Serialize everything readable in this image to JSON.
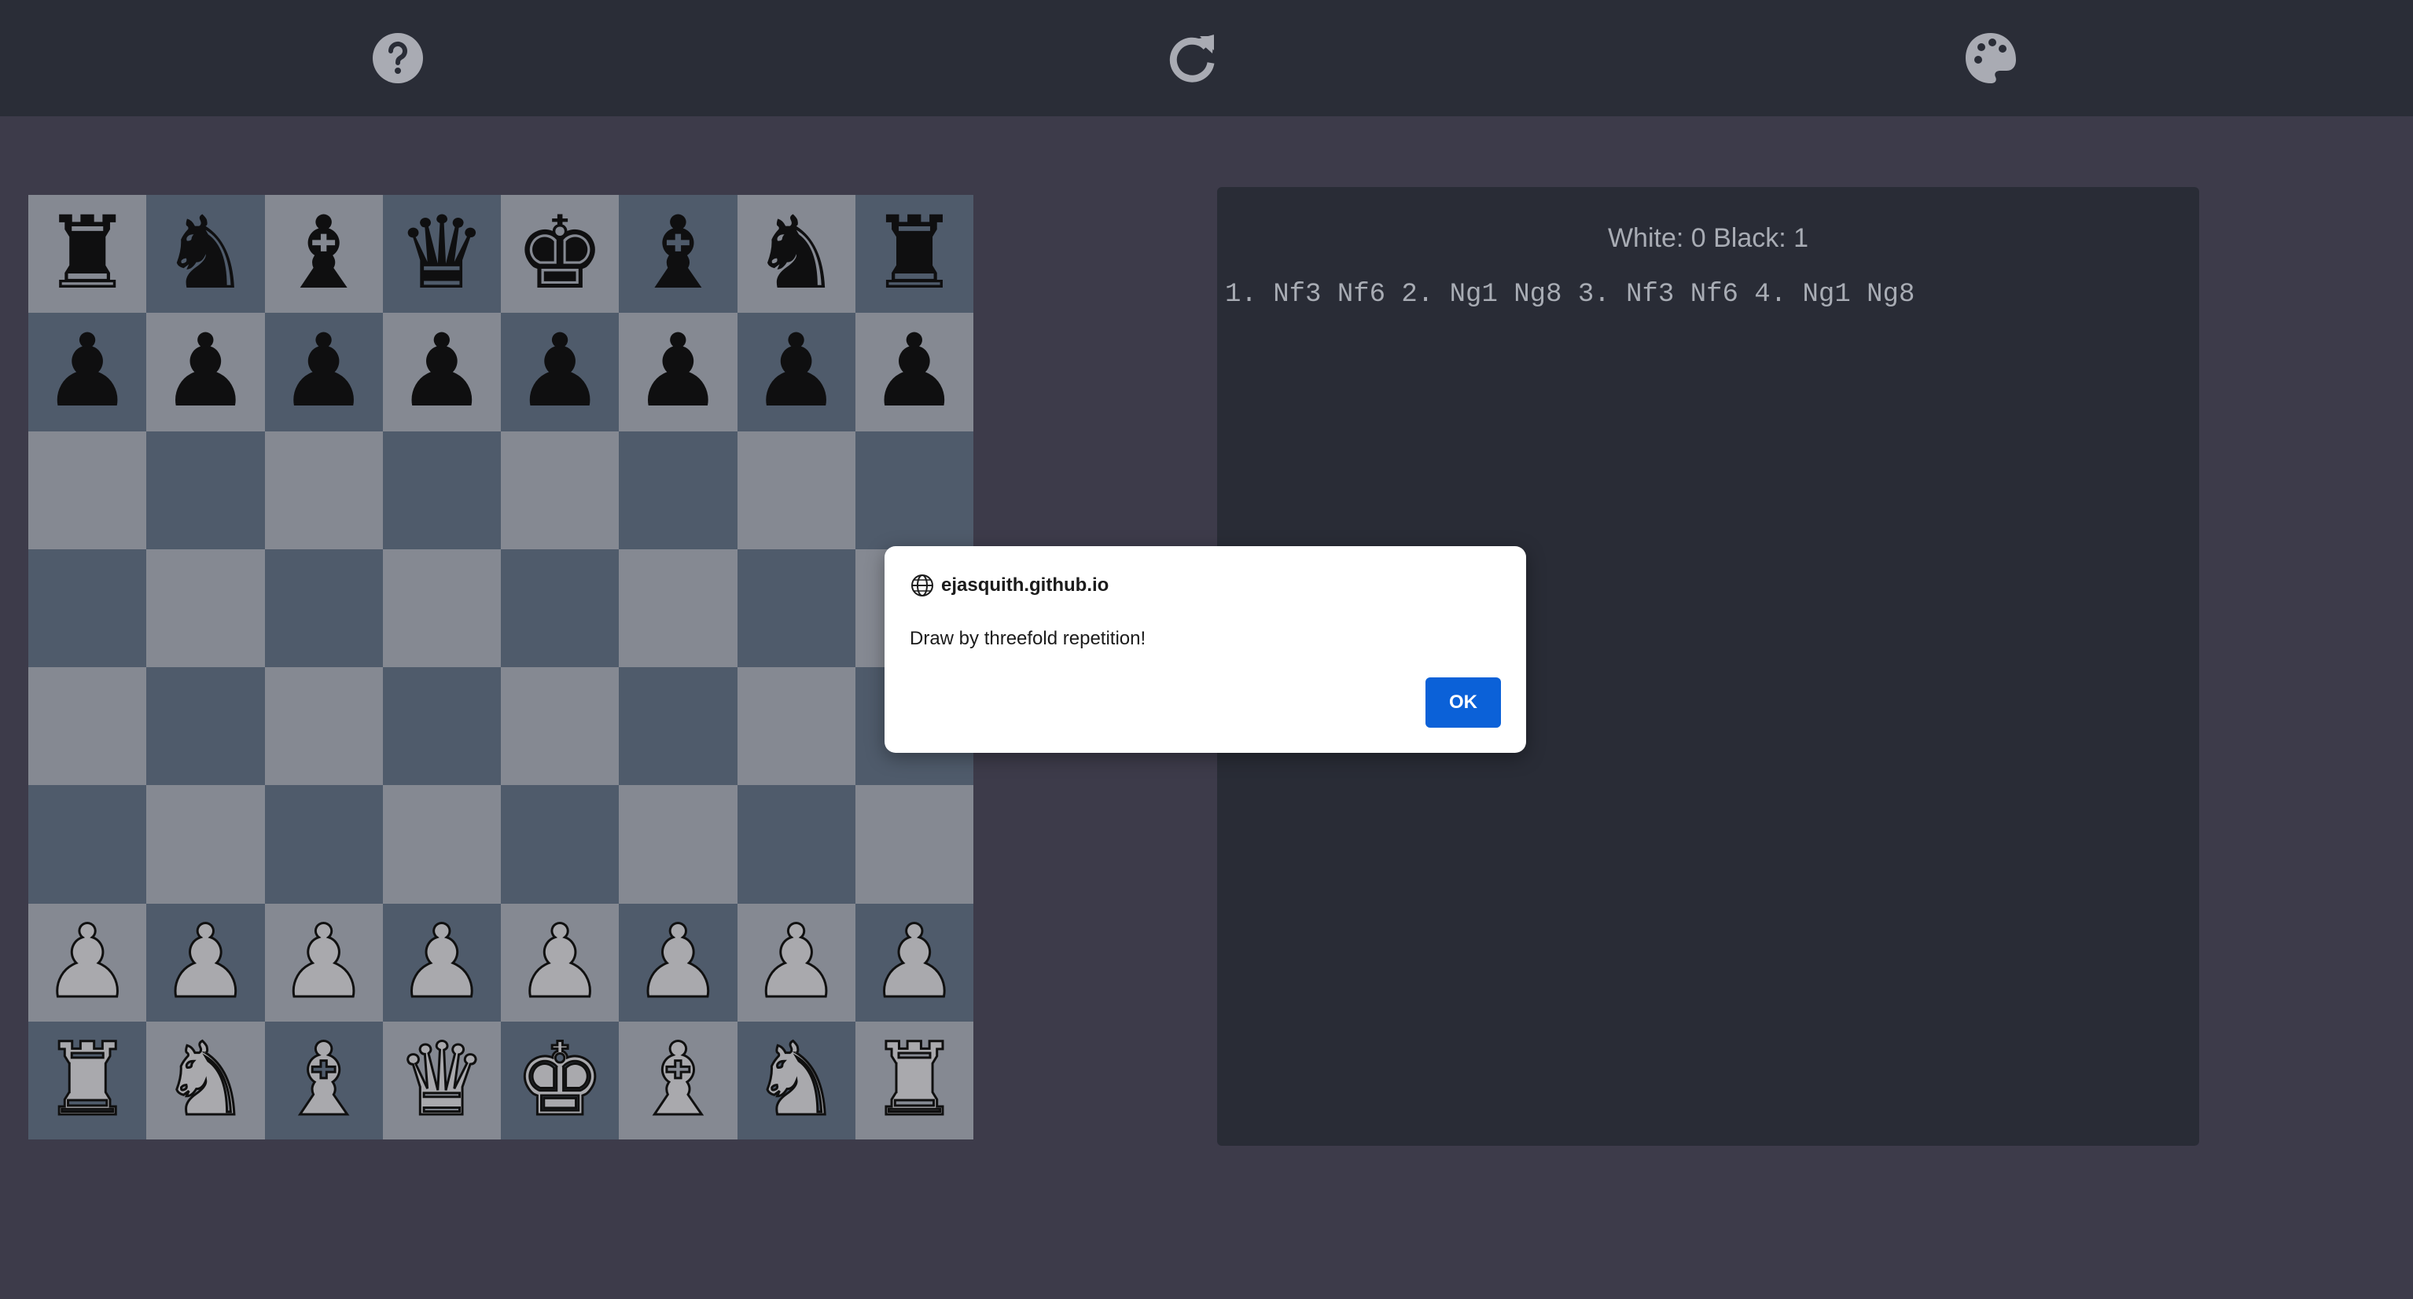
{
  "toolbar": {
    "buttons": [
      {
        "name": "help",
        "icon": "question-circle-icon"
      },
      {
        "name": "restart",
        "icon": "redo-icon"
      },
      {
        "name": "theme",
        "icon": "palette-icon"
      }
    ],
    "icon_color": "#a9abb3"
  },
  "board": {
    "light_color": "#858992",
    "dark_color": "#4f5b6b",
    "ranks": [
      [
        "br",
        "bn",
        "bb",
        "bq",
        "bk",
        "bb",
        "bn",
        "br"
      ],
      [
        "bp",
        "bp",
        "bp",
        "bp",
        "bp",
        "bp",
        "bp",
        "bp"
      ],
      [
        "",
        "",
        "",
        "",
        "",
        "",
        "",
        ""
      ],
      [
        "",
        "",
        "",
        "",
        "",
        "",
        "",
        ""
      ],
      [
        "",
        "",
        "",
        "",
        "",
        "",
        "",
        ""
      ],
      [
        "",
        "",
        "",
        "",
        "",
        "",
        "",
        ""
      ],
      [
        "wp",
        "wp",
        "wp",
        "wp",
        "wp",
        "wp",
        "wp",
        "wp"
      ],
      [
        "wr",
        "wn",
        "wb",
        "wq",
        "wk",
        "wb",
        "wn",
        "wr"
      ]
    ]
  },
  "panel": {
    "score": "White: 0 Black: 1",
    "moves": "1. Nf3 Nf6 2. Ng1 Ng8 3. Nf3 Nf6 4. Ng1 Ng8"
  },
  "dialog": {
    "origin": "ejasquith.github.io",
    "message": "Draw by threefold repetition!",
    "ok_label": "OK",
    "origin_icon": "globe-icon",
    "button_color": "#0b61d8"
  }
}
